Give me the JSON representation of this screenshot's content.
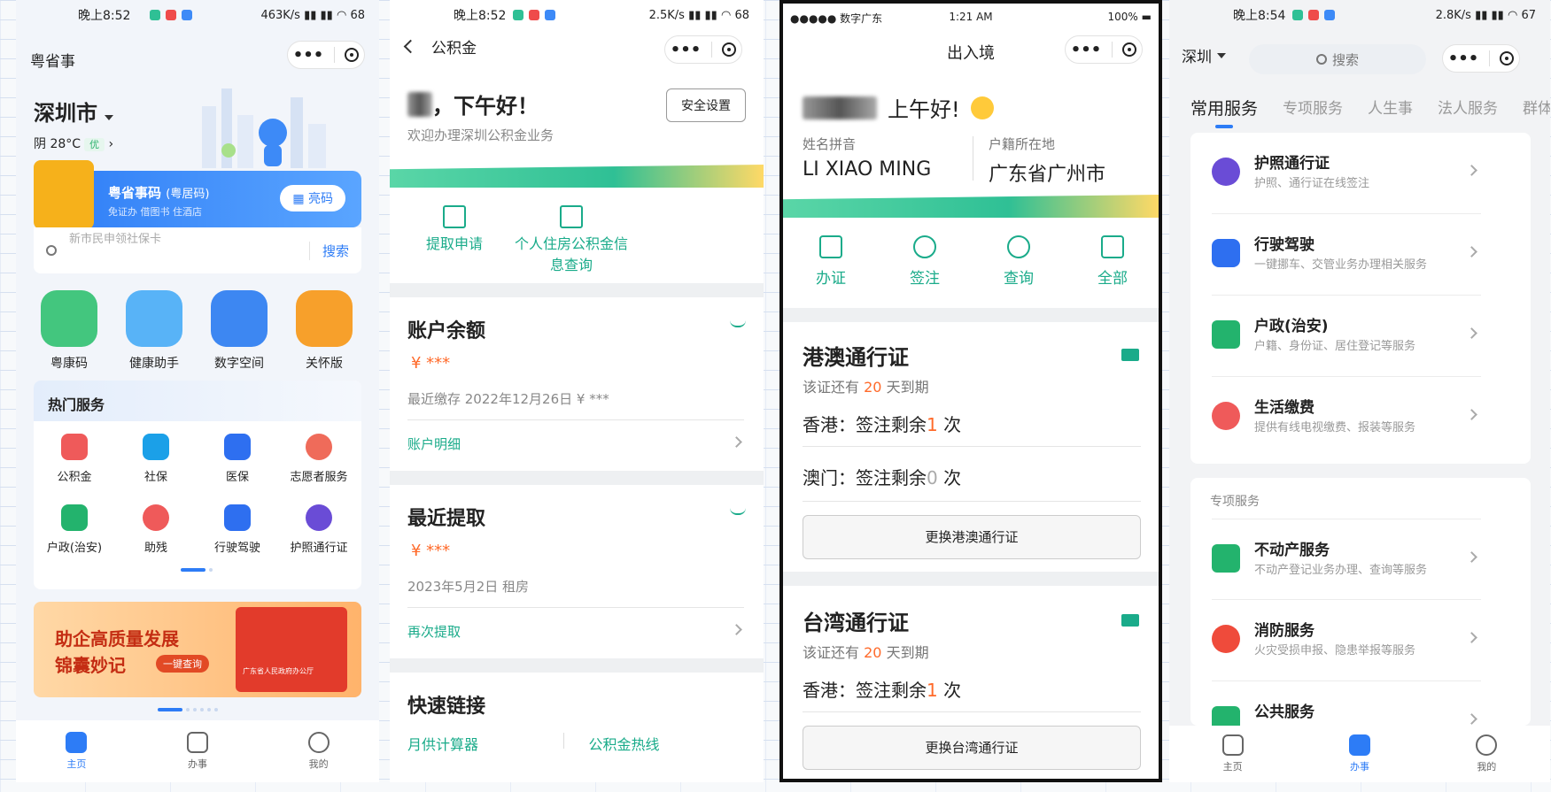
{
  "p1": {
    "status": {
      "time": "晚上8:52",
      "net": "463K/s",
      "battery": "68"
    },
    "title": "粤省事",
    "city": "深圳市",
    "weather": "阴 28°C",
    "air": "优",
    "card": {
      "title": "粤省事码",
      "title_tag": "(粤居码)",
      "sub": "免证办 借图书 住酒店",
      "btn": "亮码"
    },
    "search": {
      "placeholder": "新市民申领社保卡",
      "btn": "搜索"
    },
    "quick": [
      "粤康码",
      "健康助手",
      "数字空间",
      "关怀版"
    ],
    "hot_title": "热门服务",
    "hot": [
      "公积金",
      "社保",
      "医保",
      "志愿者服务",
      "户政(治安)",
      "助残",
      "行驶驾驶",
      "护照通行证"
    ],
    "banner": {
      "line1": "助企高质量发展",
      "line2": "锦囊妙记",
      "btn": "一键查询",
      "caption": "广东省人民政府办公厅"
    },
    "tabs": [
      "主页",
      "办事",
      "我的"
    ]
  },
  "p2": {
    "status": {
      "time": "晚上8:52",
      "net": "2.5K/s",
      "battery": "68"
    },
    "nav_title": "公积金",
    "greet": "，下午好！",
    "sub": "欢迎办理深圳公积金业务",
    "security_btn": "安全设置",
    "actions": [
      "提取申请",
      "个人住房公积金信息查询"
    ],
    "balance": {
      "title": "账户余额",
      "amount": "¥ ***",
      "meta": "最近缴存 2022年12月26日 ¥ ***",
      "link": "账户明细"
    },
    "recent": {
      "title": "最近提取",
      "amount": "¥ ***",
      "meta": "2023年5月2日 租房",
      "link": "再次提取"
    },
    "quick": {
      "title": "快速链接",
      "links": [
        "月供计算器",
        "公积金热线"
      ]
    }
  },
  "p3": {
    "status": {
      "carrier": "●●●●● 数字广东",
      "time": "1:21 AM",
      "battery": "100%"
    },
    "title": "出入境",
    "greet": "上午好!",
    "pinyin_label": "姓名拼音",
    "pinyin": "LI XIAO MING",
    "origin_label": "户籍所在地",
    "origin": "广东省广州市",
    "actions": [
      "办证",
      "签注",
      "查询",
      "全部"
    ],
    "hk": {
      "title": "港澳通行证",
      "exp_pre": "该证还有",
      "exp_days": "20",
      "exp_post": "天到期",
      "rows": [
        {
          "place": "香港：签注剩余",
          "count": "1",
          "unit": "次"
        },
        {
          "place": "澳门：签注剩余",
          "count": "0",
          "unit": "次"
        }
      ],
      "btn": "更换港澳通行证"
    },
    "tw": {
      "title": "台湾通行证",
      "exp_pre": "该证还有",
      "exp_days": "20",
      "exp_post": "天到期",
      "rows": [
        {
          "place": "香港：签注剩余",
          "count": "1",
          "unit": "次"
        }
      ],
      "btn": "更换台湾通行证"
    }
  },
  "p4": {
    "status": {
      "time": "晚上8:54",
      "net": "2.8K/s",
      "battery": "67"
    },
    "city": "深圳",
    "search": "搜索",
    "tabs": [
      "常用服务",
      "专项服务",
      "人生事",
      "法人服务",
      "群体服"
    ],
    "common": [
      {
        "title": "护照通行证",
        "sub": "护照、通行证在线签注"
      },
      {
        "title": "行驶驾驶",
        "sub": "一键挪车、交管业务办理相关服务"
      },
      {
        "title": "户政(治安)",
        "sub": "户籍、身份证、居住登记等服务"
      },
      {
        "title": "生活缴费",
        "sub": "提供有线电视缴费、报装等服务"
      }
    ],
    "special_title": "专项服务",
    "special": [
      {
        "title": "不动产服务",
        "sub": "不动产登记业务办理、查询等服务"
      },
      {
        "title": "消防服务",
        "sub": "火灾受损申报、隐患举报等服务"
      },
      {
        "title": "公共服务",
        "sub": ""
      }
    ],
    "tabbar": [
      "主页",
      "办事",
      "我的"
    ]
  },
  "colors": {
    "blue": "#2d7cf6",
    "green": "#1aab8a",
    "orange": "#ff6a2a"
  }
}
